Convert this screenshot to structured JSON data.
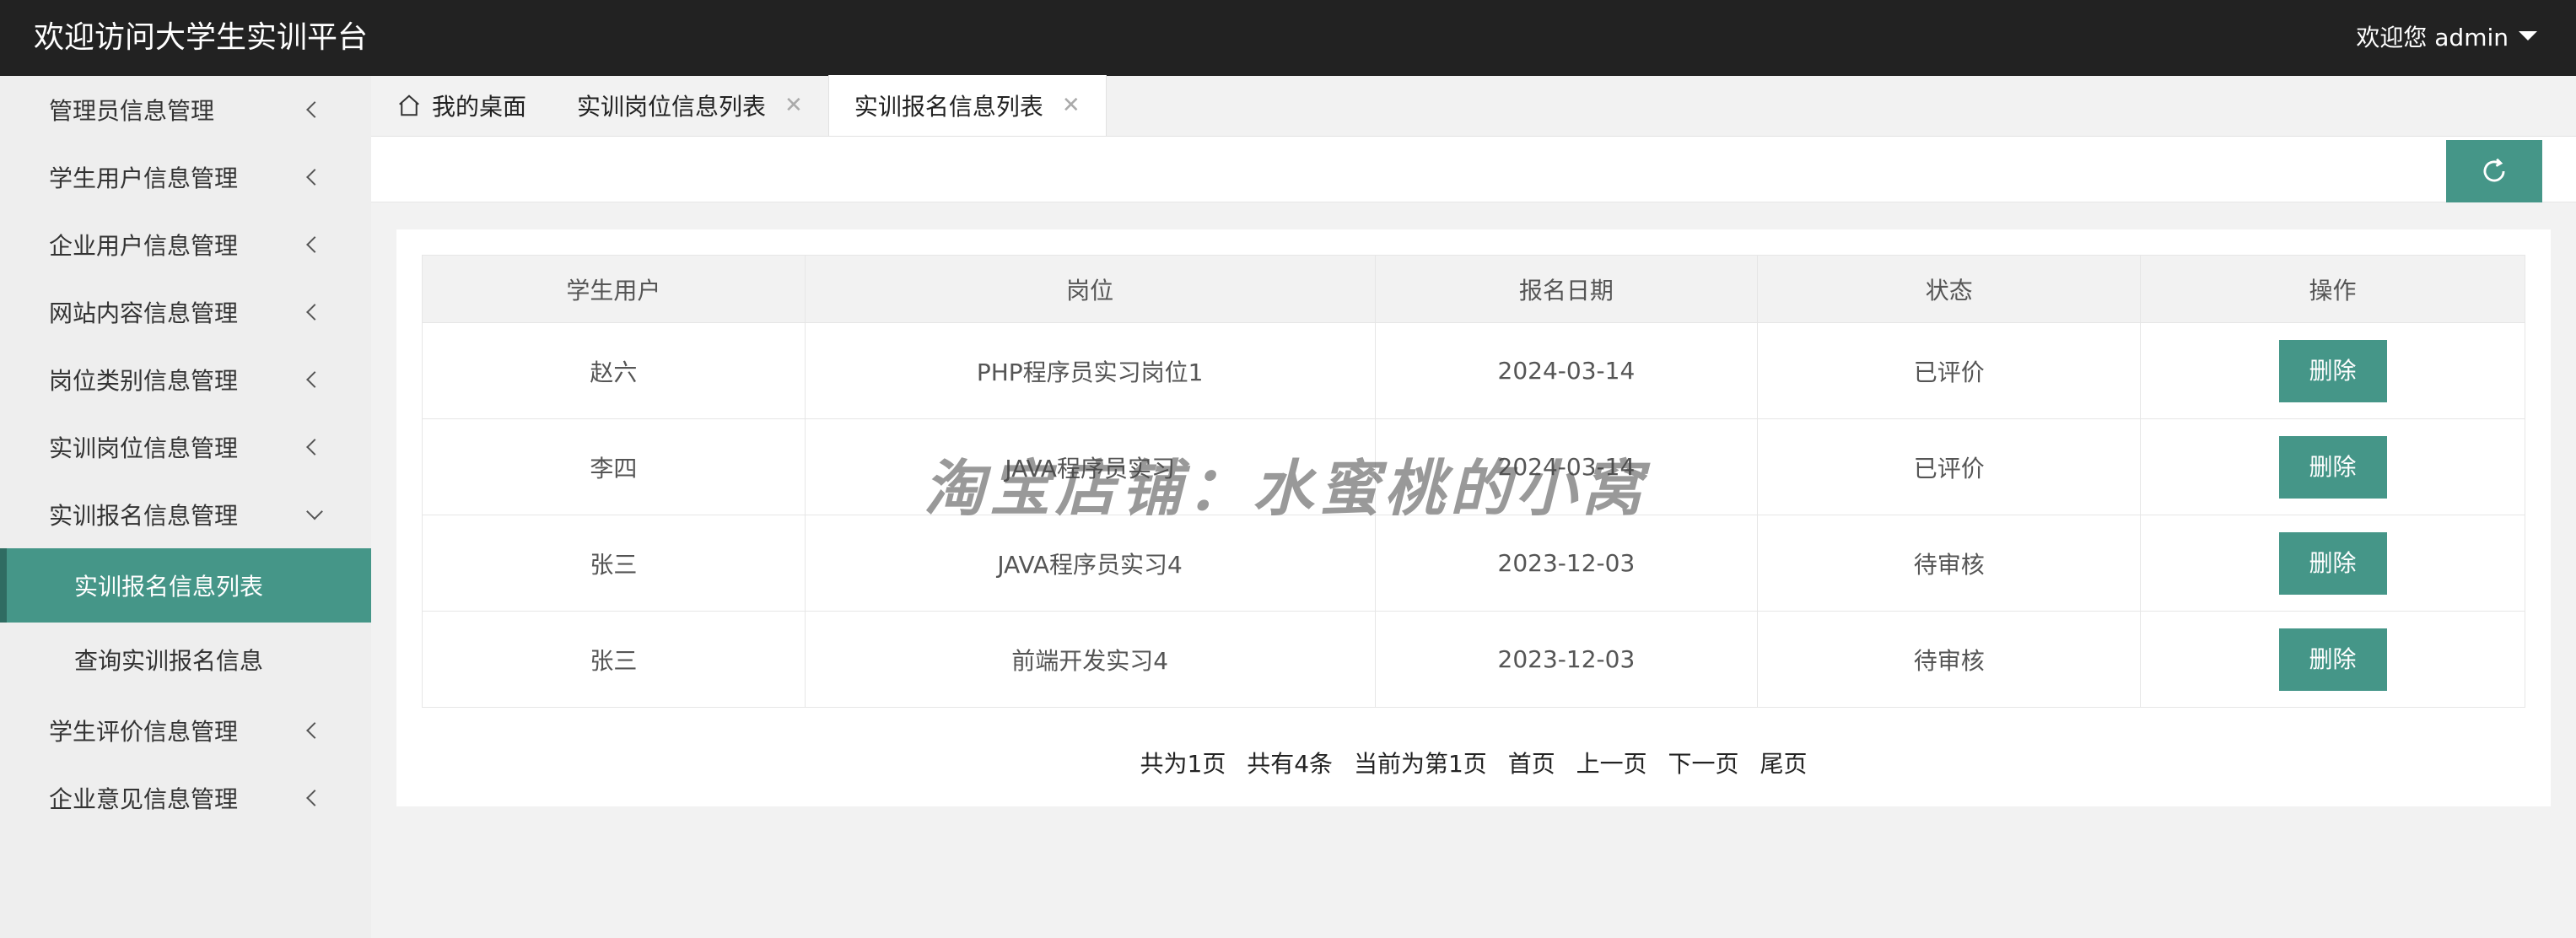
{
  "header": {
    "title": "欢迎访问大学生实训平台",
    "user_label": "欢迎您 admin"
  },
  "sidebar": {
    "items": [
      {
        "label": "管理员信息管理"
      },
      {
        "label": "学生用户信息管理"
      },
      {
        "label": "企业用户信息管理"
      },
      {
        "label": "网站内容信息管理"
      },
      {
        "label": "岗位类别信息管理"
      },
      {
        "label": "实训岗位信息管理"
      },
      {
        "label": "实训报名信息管理"
      },
      {
        "label": "学生评价信息管理"
      },
      {
        "label": "企业意见信息管理"
      }
    ],
    "sub_items": [
      {
        "label": "实训报名信息列表"
      },
      {
        "label": "查询实训报名信息"
      }
    ]
  },
  "tabs": [
    {
      "label": "我的桌面"
    },
    {
      "label": "实训岗位信息列表"
    },
    {
      "label": "实训报名信息列表"
    }
  ],
  "table": {
    "columns": [
      "学生用户",
      "岗位",
      "报名日期",
      "状态",
      "操作"
    ],
    "rows": [
      {
        "student": "赵六",
        "position": "PHP程序员实习岗位1",
        "date": "2024-03-14",
        "status": "已评价",
        "action": "删除"
      },
      {
        "student": "李四",
        "position": "JAVA程序员实习",
        "date": "2024-03-14",
        "status": "已评价",
        "action": "删除"
      },
      {
        "student": "张三",
        "position": "JAVA程序员实习4",
        "date": "2023-12-03",
        "status": "待审核",
        "action": "删除"
      },
      {
        "student": "张三",
        "position": "前端开发实习4",
        "date": "2023-12-03",
        "status": "待审核",
        "action": "删除"
      }
    ]
  },
  "pager": {
    "total_pages": "共为1页",
    "total_items": "共有4条",
    "current": "当前为第1页",
    "first": "首页",
    "prev": "上一页",
    "next": "下一页",
    "last": "尾页"
  },
  "watermark": "淘宝店铺：水蜜桃的小窝",
  "colors": {
    "accent": "#459688",
    "header_bg": "#222222"
  }
}
